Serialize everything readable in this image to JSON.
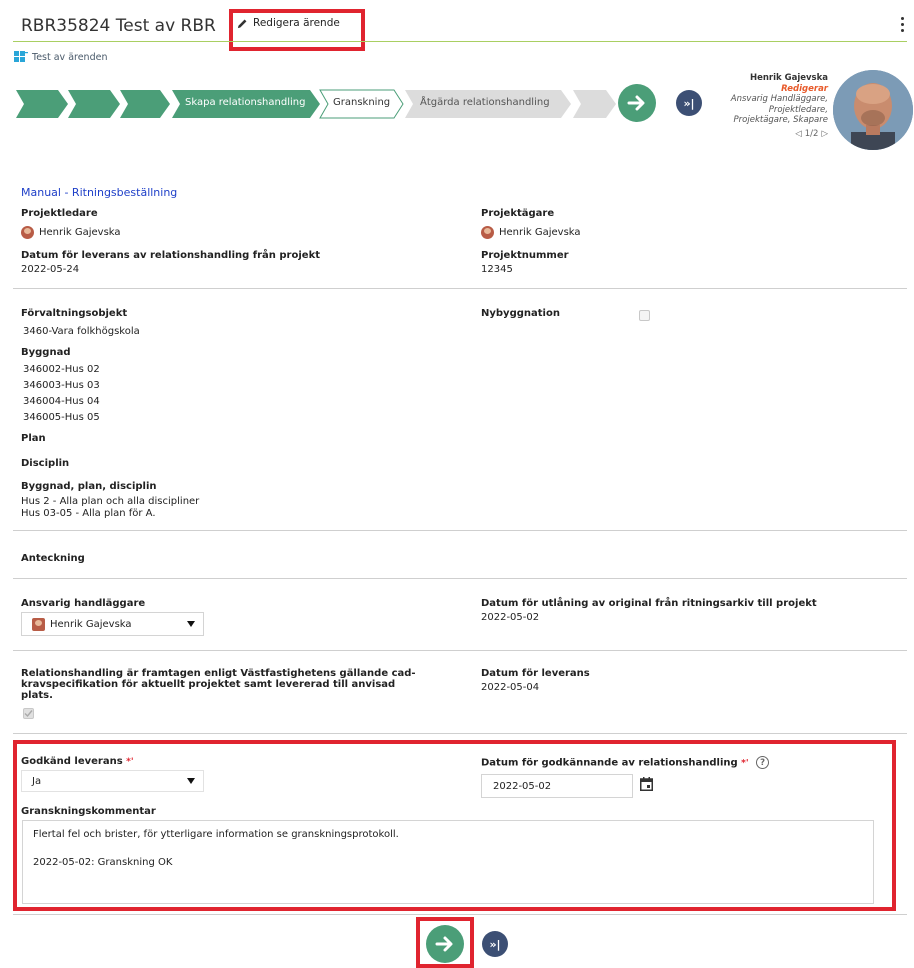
{
  "header": {
    "title": "RBR35824 Test av RBR",
    "edit_label": "Redigera ärende"
  },
  "case_type": "Test av ärenden",
  "process": {
    "steps": [
      "Skapa relationshandling",
      "Granskning",
      "Åtgärda relationshandling"
    ],
    "skip_label": "»|"
  },
  "user_panel": {
    "name": "Henrik Gajevska",
    "status": "Redigerar",
    "roles": [
      "Ansvarig Handläggare,",
      "Projektledare,",
      "Projektägare, Skapare"
    ],
    "pager": "1/2"
  },
  "form": {
    "section_title": "Manual - Ritningsbeställning",
    "projektledare_label": "Projektledare",
    "projektledare_value": "Henrik Gajevska",
    "projektagare_label": "Projektägare",
    "projektagare_value": "Henrik Gajevska",
    "datum_leverans_projekt_label": "Datum för leverans av relationshandling från projekt",
    "datum_leverans_projekt_value": "2022-05-24",
    "projektnummer_label": "Projektnummer",
    "projektnummer_value": "12345",
    "forvaltningsobjekt_label": "Förvaltningsobjekt",
    "forvaltningsobjekt_value": "3460-Vara folkhögskola",
    "nybyggnation_label": "Nybyggnation",
    "byggnad_label": "Byggnad",
    "byggnad_values": [
      "346002-Hus 02",
      "346003-Hus 03",
      "346004-Hus 04",
      "346005-Hus 05"
    ],
    "plan_label": "Plan",
    "disciplin_label": "Disciplin",
    "byggnad_plan_disciplin_label": "Byggnad, plan, disciplin",
    "byggnad_plan_disciplin_values": [
      "Hus 2 - Alla plan och alla discipliner",
      "Hus 03-05 - Alla plan för A."
    ],
    "anteckning_label": "Anteckning",
    "ansvarig_label": "Ansvarig handläggare",
    "ansvarig_value": "Henrik Gajevska",
    "datum_utlaning_label": "Datum för utlåning av original från ritningsarkiv till projekt",
    "datum_utlaning_value": "2022-05-02",
    "relationshandling_label_lines": [
      "Relationshandling är framtagen enligt Västfastighetens gällande cad-",
      "kravspecifikation för aktuellt projektet samt levererad till anvisad",
      "plats."
    ],
    "datum_leverans_label": "Datum för leverans",
    "datum_leverans_value": "2022-05-04",
    "godkand_label": "Godkänd leverans",
    "required_mark": "*'",
    "godkand_value": "Ja",
    "datum_godkannande_label": "Datum för godkännande av relationshandling",
    "datum_godkannande_value": "2022-05-02",
    "help_mark": "?",
    "granskning_label": "Granskningskommentar",
    "granskning_lines": [
      "Flertal fel och brister, för ytterligare information se granskningsprotokoll.",
      "",
      "2022-05-02: Granskning OK"
    ]
  },
  "colors": {
    "accent_green": "#4b9e78",
    "navy": "#3c4f74",
    "highlight_red": "#e0242f",
    "link_blue": "#1e3fc8",
    "status_orange": "#e85a2a"
  }
}
